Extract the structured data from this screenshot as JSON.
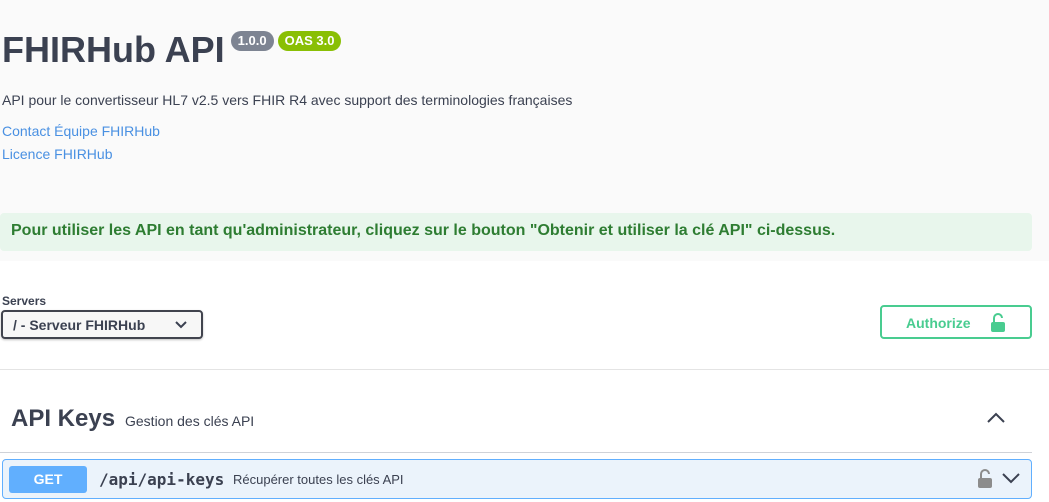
{
  "header": {
    "title": "FHIRHub API",
    "version_badge": "1.0.0",
    "oas_badge": "OAS 3.0",
    "description": "API pour le convertisseur HL7 v2.5 vers FHIR R4 avec support des terminologies françaises",
    "contact_link": "Contact Équipe FHIRHub",
    "license_link": "Licence FHIRHub"
  },
  "notice": {
    "text": "Pour utiliser les API en tant qu'administrateur, cliquez sur le bouton \"Obtenir et utiliser la clé API\" ci-dessus."
  },
  "servers": {
    "label": "Servers",
    "selected": "/ - Serveur FHIRHub"
  },
  "authorize": {
    "label": "Authorize"
  },
  "tag": {
    "name": "API Keys",
    "description": "Gestion des clés API",
    "operations": [
      {
        "method": "GET",
        "path": "/api/api-keys",
        "summary": "Récupérer toutes les clés API"
      }
    ]
  },
  "colors": {
    "get": "#61affe",
    "authorize": "#49cc90",
    "link": "#4990e2",
    "oas_badge": "#89bf04",
    "version_badge": "#7d8492",
    "notice_text": "#2e7d32"
  },
  "icons": {
    "server_dropdown": "chevron-down-icon",
    "authorize": "unlock-icon",
    "tag_toggle": "chevron-up-icon",
    "op_lock": "unlock-icon",
    "op_toggle": "chevron-down-icon"
  }
}
